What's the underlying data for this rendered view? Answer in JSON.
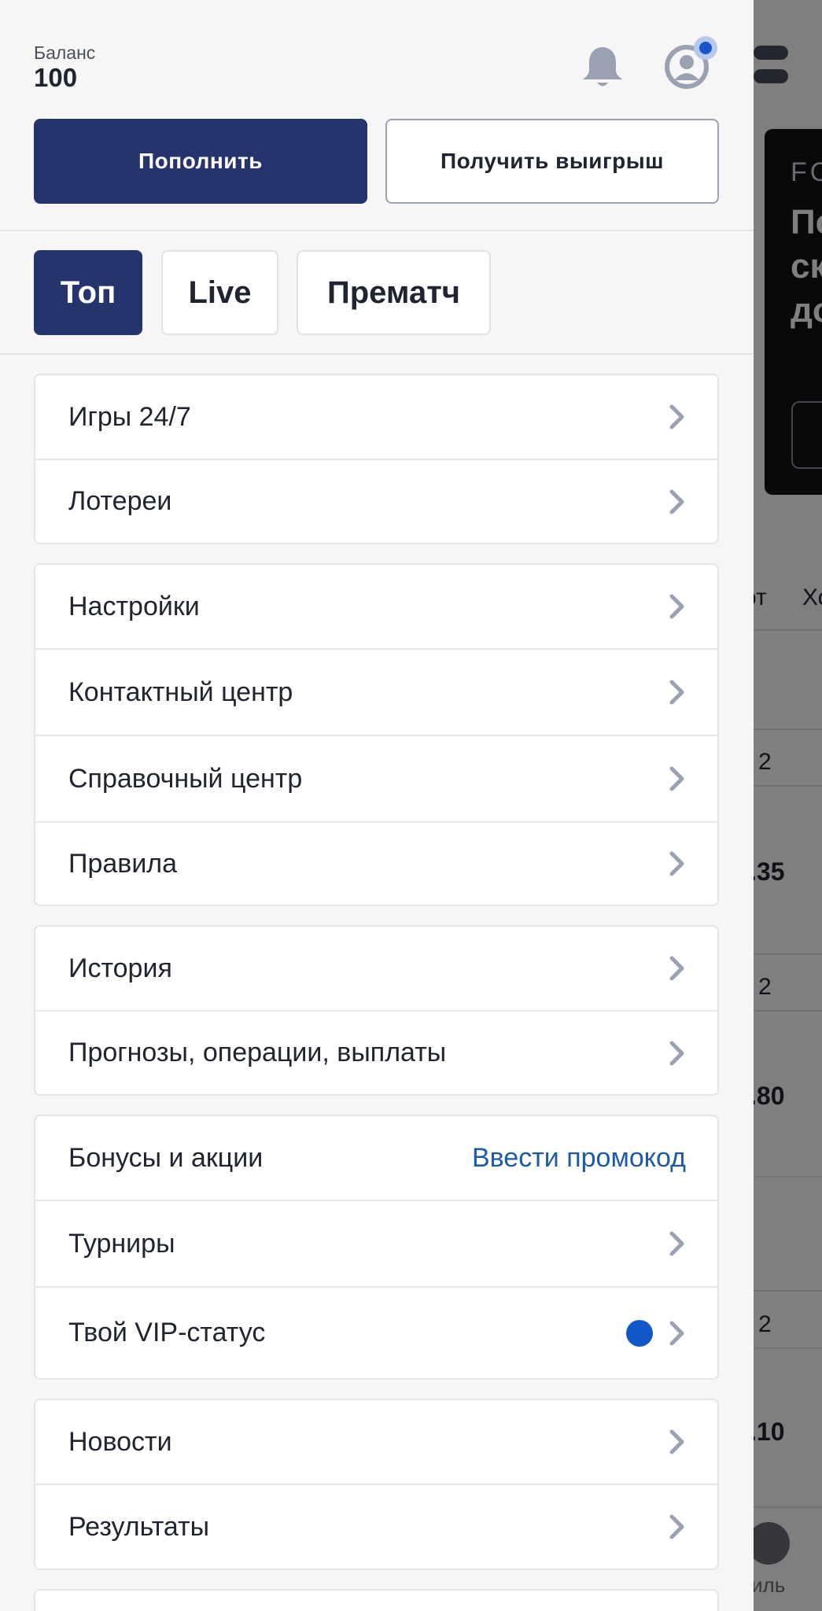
{
  "header": {
    "balance_label": "Баланс",
    "balance_value": "100",
    "icons": [
      "bell-icon",
      "user-avatar-icon"
    ],
    "notification_dot_color": "#1a56c9"
  },
  "actions": {
    "deposit_label": "Пополнить",
    "withdraw_label": "Получить выигрыш"
  },
  "tabs": [
    {
      "label": "Топ",
      "active": true
    },
    {
      "label": "Live",
      "active": false
    },
    {
      "label": "Прематч",
      "active": false
    }
  ],
  "menu": {
    "group1": [
      {
        "label": "Игры 24/7"
      },
      {
        "label": "Лотереи"
      }
    ],
    "group2": [
      {
        "label": "Настройки"
      },
      {
        "label": "Контактный центр"
      },
      {
        "label": "Справочный центр"
      },
      {
        "label": "Правила"
      }
    ],
    "group3": [
      {
        "label": "История"
      },
      {
        "label": "Прогнозы, операции, выплаты"
      }
    ],
    "group4": [
      {
        "label": "Бонусы и акции",
        "action": "Ввести промокод"
      },
      {
        "label": "Турниры"
      },
      {
        "label": "Твой VIP-статус"
      }
    ],
    "group5": [
      {
        "label": "Новости"
      },
      {
        "label": "Результаты"
      }
    ]
  },
  "background": {
    "banner_kicker": "FO",
    "banner_text": "По\nск\nдо",
    "col_header": "от",
    "col_header2": "Хо",
    "row_nums": [
      "2",
      "2",
      "2"
    ],
    "odds": [
      ".35",
      ".80",
      ".10"
    ],
    "nav_label": "иль"
  },
  "colors": {
    "primary": "#25346d",
    "link": "#1d5aa8",
    "vip_dot": "#1257c7"
  }
}
